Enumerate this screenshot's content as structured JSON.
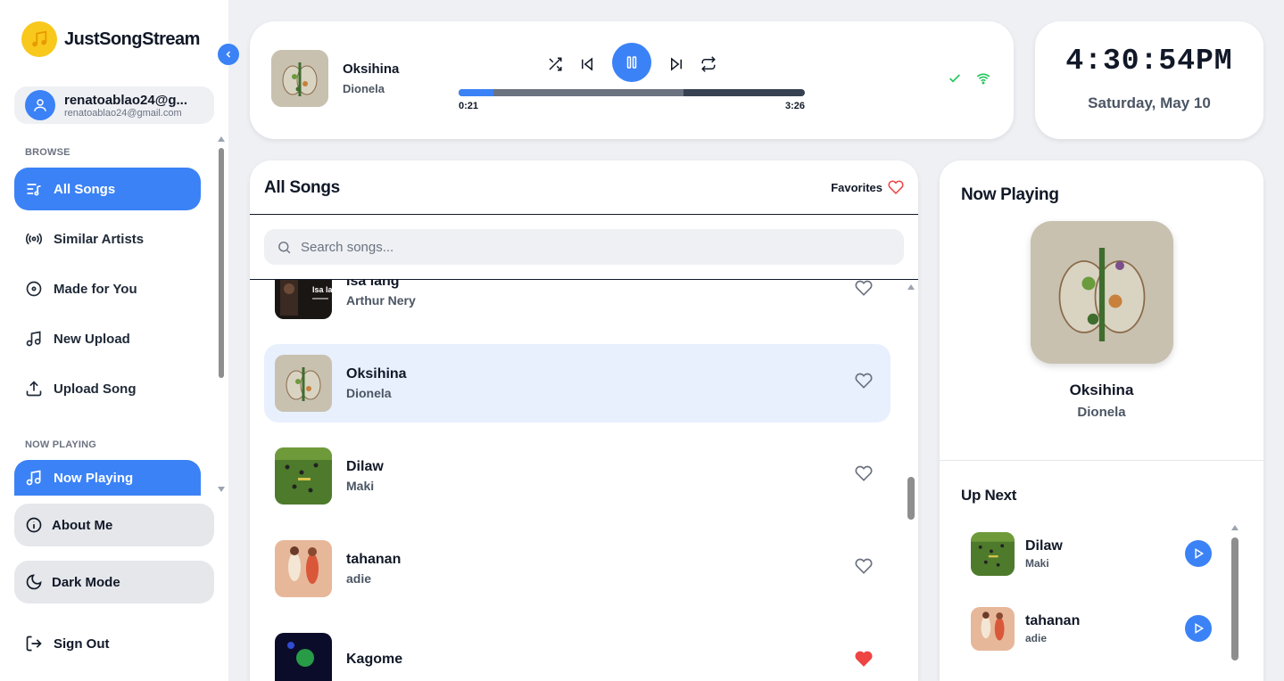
{
  "app": {
    "name": "JustSongStream"
  },
  "user": {
    "name": "renatoablao24@g...",
    "email": "renatoablao24@gmail.com"
  },
  "sidebar": {
    "browse_label": "BROWSE",
    "items": [
      {
        "label": "All Songs",
        "icon": "list-music-icon",
        "active": true
      },
      {
        "label": "Similar Artists",
        "icon": "broadcast-icon",
        "active": false
      },
      {
        "label": "Made for You",
        "icon": "disc-icon",
        "active": false
      },
      {
        "label": "New Upload",
        "icon": "music-note-icon",
        "active": false
      },
      {
        "label": "Upload Song",
        "icon": "upload-icon",
        "active": false
      }
    ],
    "now_playing_label": "NOW PLAYING",
    "now_playing_item": "Now Playing",
    "about": "About Me",
    "dark_mode": "Dark Mode",
    "sign_out": "Sign Out"
  },
  "player": {
    "title": "Oksihina",
    "artist": "Dionela",
    "current_time": "0:21",
    "total_time": "3:26",
    "progress": 0.1
  },
  "clock": {
    "time": "4:30:54PM",
    "date": "Saturday, May 10"
  },
  "songs": {
    "title": "All Songs",
    "favorites_label": "Favorites",
    "search_placeholder": "Search songs...",
    "items": [
      {
        "title": "Isa lang",
        "artist": "Arthur Nery",
        "favorite": false
      },
      {
        "title": "Oksihina",
        "artist": "Dionela",
        "favorite": false,
        "active": true
      },
      {
        "title": "Dilaw",
        "artist": "Maki",
        "favorite": false
      },
      {
        "title": "tahanan",
        "artist": "adie",
        "favorite": false
      },
      {
        "title": "Kagome",
        "artist": "",
        "favorite": true
      }
    ]
  },
  "now_playing": {
    "heading": "Now Playing",
    "title": "Oksihina",
    "artist": "Dionela",
    "up_next_heading": "Up Next",
    "up_next": [
      {
        "title": "Dilaw",
        "artist": "Maki"
      },
      {
        "title": "tahanan",
        "artist": "adie"
      }
    ]
  },
  "colors": {
    "accent": "#3b82f6",
    "logo": "#f8c81c",
    "active_row": "#e8f0fe",
    "favorite": "#ef4444",
    "status": "#22c55e"
  }
}
